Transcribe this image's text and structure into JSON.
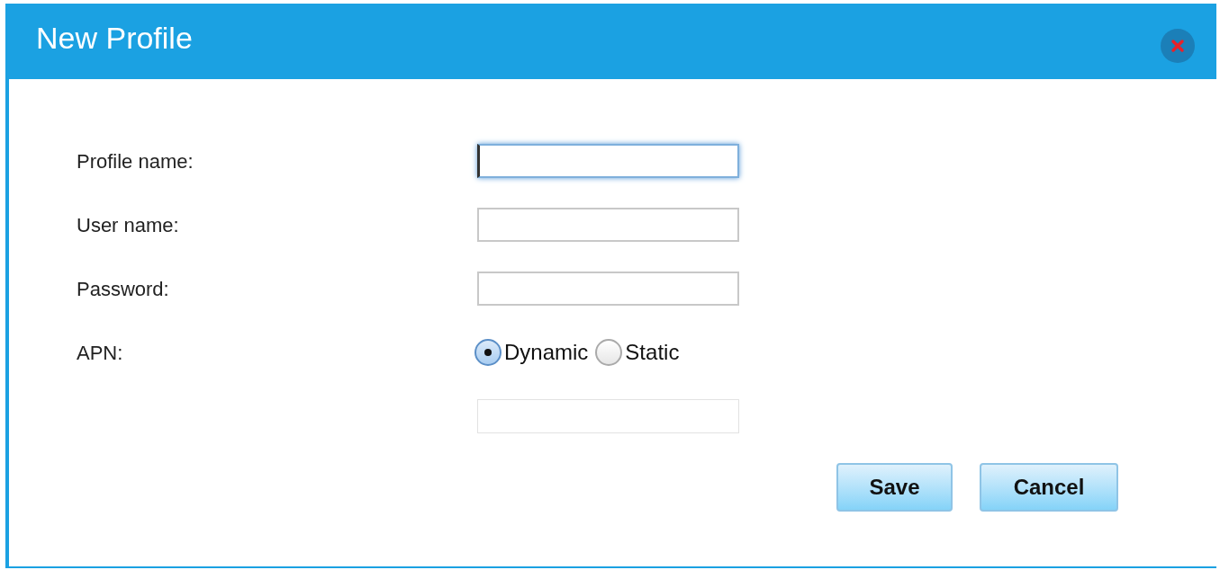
{
  "dialog": {
    "title": "New Profile"
  },
  "fields": [
    {
      "kind": "text",
      "label": "Profile name:",
      "focused": true
    },
    {
      "kind": "text",
      "label": "User name:",
      "focused": false
    },
    {
      "kind": "text",
      "label": "Password:",
      "focused": false
    },
    {
      "kind": "radio",
      "label": "APN:",
      "options": [
        {
          "label": "Dynamic",
          "selected": true
        },
        {
          "label": "Static",
          "selected": false
        }
      ]
    },
    {
      "kind": "text",
      "focused": false,
      "disabled": true
    }
  ],
  "buttons": [
    "Save",
    "Cancel"
  ]
}
